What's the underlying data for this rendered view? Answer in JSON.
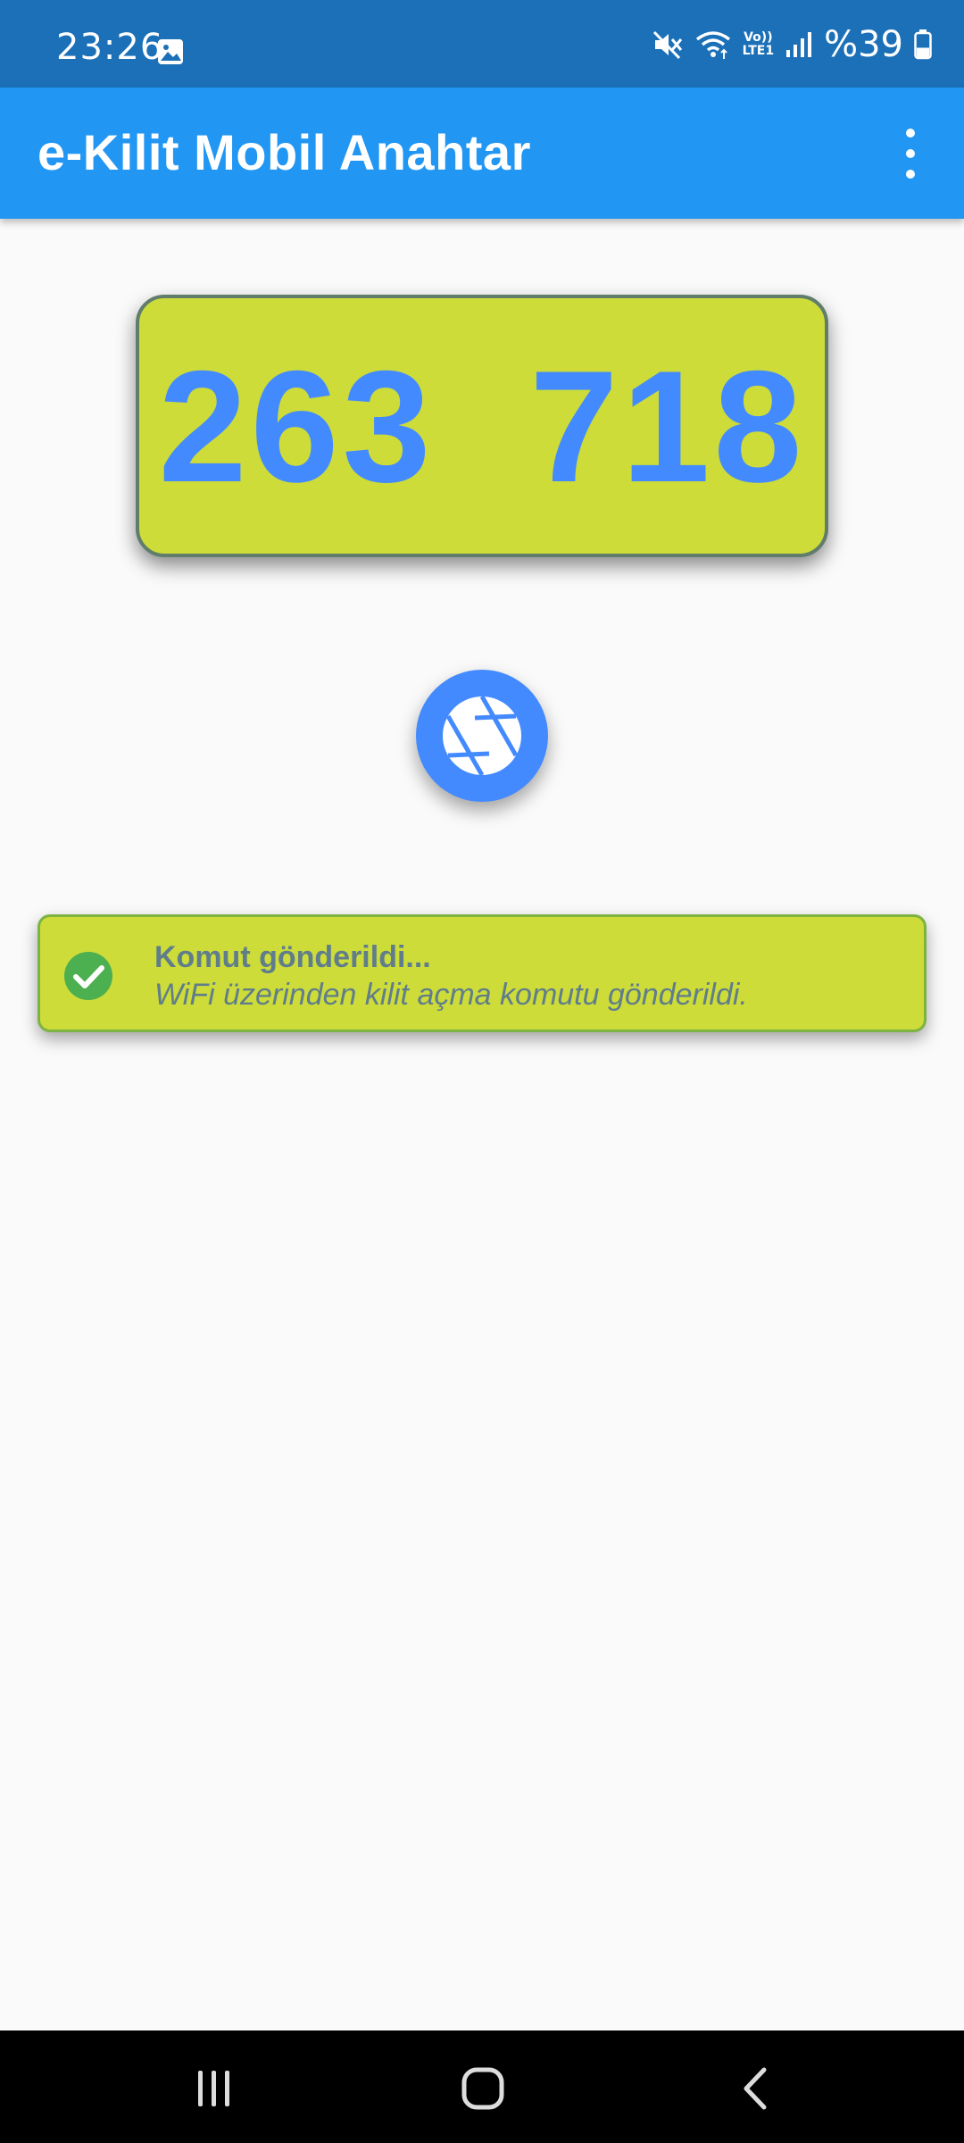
{
  "status_bar": {
    "time": "23:26",
    "lte_line1": "Vo))",
    "lte_line2": "LTE1",
    "battery_percent": "%39",
    "battery_level": 0.39
  },
  "app_bar": {
    "title": "e-Kilit Mobil Anahtar",
    "menu_icon": "more-vert-icon"
  },
  "code_card": {
    "code": "263  718"
  },
  "action": {
    "icon": "camera-shutter-icon"
  },
  "notice": {
    "icon": "check-circle-icon",
    "title": "Komut gönderildi...",
    "message": "WiFi üzerinden kilit açma komutu gönderildi."
  },
  "nav_bar": {
    "recents_icon": "recents-icon",
    "home_icon": "home-icon",
    "back_icon": "back-icon"
  },
  "colors": {
    "status_bar": "#1b70b8",
    "app_bar": "#2196f3",
    "card": "#cddc39",
    "accent_blue": "#448aff",
    "text_grey": "#607d8b",
    "success_green": "#4caf50"
  }
}
